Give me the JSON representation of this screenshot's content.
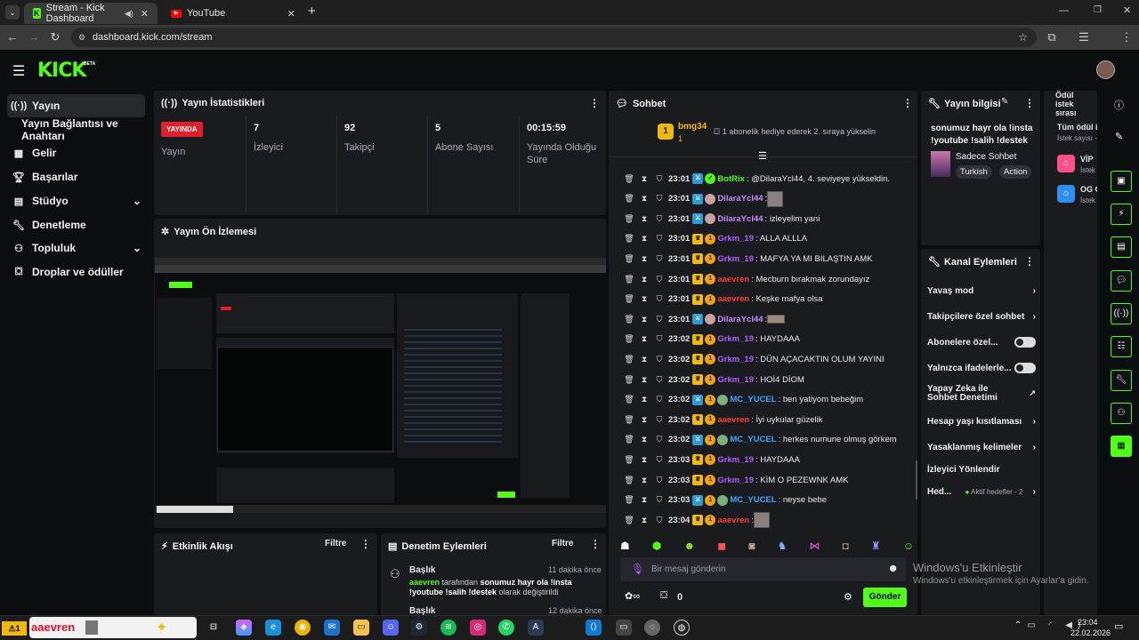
{
  "browser": {
    "tabs": [
      {
        "title": "Stream - Kick Dashboard",
        "favicon": "K"
      },
      {
        "title": "YouTube",
        "favicon": "▶"
      }
    ],
    "new_tab": "+",
    "url": "dashboard.kick.com/stream"
  },
  "app": {
    "logo": "KICK",
    "beta": "BETA"
  },
  "sidebar": {
    "items": [
      {
        "label": "Yayın",
        "icon": "broadcast-icon"
      },
      {
        "label": "Yayın Bağlantısı ve Anahtarı"
      },
      {
        "label": "Gelir",
        "icon": "revenue-icon"
      },
      {
        "label": "Başarılar",
        "icon": "trophy-icon"
      },
      {
        "label": "Stüdyo",
        "icon": "studio-icon"
      },
      {
        "label": "Denetleme",
        "icon": "wrench-icon"
      },
      {
        "label": "Topluluk",
        "icon": "community-icon"
      },
      {
        "label": "Droplar ve ödüller",
        "icon": "gift-icon"
      }
    ]
  },
  "stats": {
    "title": "Yayın İstatistikleri",
    "live_badge": "YAYINDA",
    "live_label": "Yayın",
    "items": [
      {
        "value": "7",
        "label": "İzleyici"
      },
      {
        "value": "92",
        "label": "Takipçi"
      },
      {
        "value": "5",
        "label": "Abone Sayısı"
      },
      {
        "value": "00:15:59",
        "label": "Yayında Olduğu Süre"
      }
    ]
  },
  "preview": {
    "title": "Yayın Ön İzlemesi"
  },
  "activity": {
    "title": "Etkinlik Akışı",
    "filter": "Filtre"
  },
  "mod_actions": {
    "title": "Denetim Eylemleri",
    "filter": "Filtre",
    "entry_title": "Başlık",
    "entry_time": "11 dakika önce",
    "entry_user": "aaevren",
    "entry_text_a": " tarafından ",
    "entry_text_b": "sonumuz hayr ola !insta !youtube !salih !destek",
    "entry_text_c": " olarak değiştirildi",
    "entry2_title": "Başlık",
    "entry2_time": "12 dakika önce"
  },
  "chat": {
    "title": "Sohbet",
    "pinned_user": "bmg34",
    "pinned_rank": "1",
    "pinned_sub": "1",
    "pinned_text": "1 abonelik hediye ederek 2. sıraya yükselin",
    "messages": [
      {
        "time": "23:01",
        "user": "BotRix",
        "color": "#53fc18",
        "text": ": @DilaraYcl44, 4. seviyeye yükseldin."
      },
      {
        "time": "23:01",
        "user": "DilaraYcl44",
        "color": "#c58cff",
        "text": ": "
      },
      {
        "time": "23:01",
        "user": "DilaraYcl44",
        "color": "#c58cff",
        "text": ": izleyelim yani"
      },
      {
        "time": "23:01",
        "user": "Grkm_19",
        "color": "#b45cff",
        "text": ": ALLA ALLLA"
      },
      {
        "time": "23:01",
        "user": "Grkm_19",
        "color": "#b45cff",
        "text": ": MAFYA YA MI BILAŞTIN AMK"
      },
      {
        "time": "23:01",
        "user": "aaevren",
        "color": "#ff3c3c",
        "text": ": Mecburn bırakmak zorundayız"
      },
      {
        "time": "23:01",
        "user": "aaevren",
        "color": "#ff3c3c",
        "text": ": Keşke mafya olsa"
      },
      {
        "time": "23:01",
        "user": "DilaraYcl44",
        "color": "#c58cff",
        "text": ": "
      },
      {
        "time": "23:02",
        "user": "Grkm_19",
        "color": "#b45cff",
        "text": ": HAYDAAA"
      },
      {
        "time": "23:02",
        "user": "Grkm_19",
        "color": "#b45cff",
        "text": ": DÜN AÇACAKTIN OLUM YAYINI"
      },
      {
        "time": "23:02",
        "user": "Grkm_19",
        "color": "#b45cff",
        "text": ": HOİ4 DİOM"
      },
      {
        "time": "23:02",
        "user": "MC_YUCEL",
        "color": "#3aa7ff",
        "text": ": ben yatiyom bebeğim"
      },
      {
        "time": "23:02",
        "user": "aaevren",
        "color": "#ff3c3c",
        "text": ": İyi uykular güzelik"
      },
      {
        "time": "23:02",
        "user": "MC_YUCEL",
        "color": "#3aa7ff",
        "text": ": herkes numune olmuş görkem"
      },
      {
        "time": "23:03",
        "user": "Grkm_19",
        "color": "#b45cff",
        "text": ": HAYDAAA"
      },
      {
        "time": "23:03",
        "user": "Grkm_19",
        "color": "#b45cff",
        "text": ": KİM O PEZEWNK AMK"
      },
      {
        "time": "23:03",
        "user": "MC_YUCEL",
        "color": "#3aa7ff",
        "text": ": neyse bebe"
      },
      {
        "time": "23:04",
        "user": "aaevren",
        "color": "#ff3c3c",
        "text": ": "
      }
    ],
    "input_placeholder": "Bir mesaj gönderin",
    "points": "0",
    "send": "Gönder"
  },
  "stream_info": {
    "title": "Yayın bilgisi",
    "stream_title": "sonumuz hayr ola !insta !youtube !salih !destek",
    "category": "Sadece Sohbet",
    "tags": [
      "Turkish",
      "Action"
    ]
  },
  "channel_actions": {
    "title": "Kanal Eylemleri",
    "items": [
      {
        "label": "Yavaş mod",
        "kind": "chevron"
      },
      {
        "label": "Takipçilere özel sohbet",
        "kind": "chevron"
      },
      {
        "label": "Abonelere özel...",
        "kind": "toggle"
      },
      {
        "label": "Yalnızca ifadelerle...",
        "kind": "toggle"
      },
      {
        "label": "Yapay Zeka ile Sohbet Denetimi",
        "kind": "external"
      },
      {
        "label": "Hesap yaşı kısıtlaması",
        "kind": "chevron"
      },
      {
        "label": "Yasaklanmış kelimeler",
        "kind": "chevron"
      },
      {
        "label": "İzleyici Yönlendir",
        "kind": "none"
      },
      {
        "label": "Hed...",
        "kind": "chevron",
        "sub": "Aktif hedefler - 2"
      }
    ]
  },
  "rewards": {
    "title": "Ödül istek sırası",
    "all_label": "Tüm ödül i",
    "all_sub": "İstek sayısı -",
    "items": [
      {
        "name": "VİP",
        "sub": "İstek"
      },
      {
        "name": "OG C",
        "sub": "İstek"
      }
    ]
  },
  "overlay": {
    "line1": "Windows'u Etkinleştir",
    "line2": "Windows'u etkinleştirmek için Ayarlar'a gidin."
  },
  "taskbar": {
    "search_text": "aaevren",
    "time": "23:04",
    "date": "22.02.2026"
  },
  "colors": {
    "accent": "#53fc18",
    "live": "#e01f2a",
    "panel": "#191b1f"
  }
}
